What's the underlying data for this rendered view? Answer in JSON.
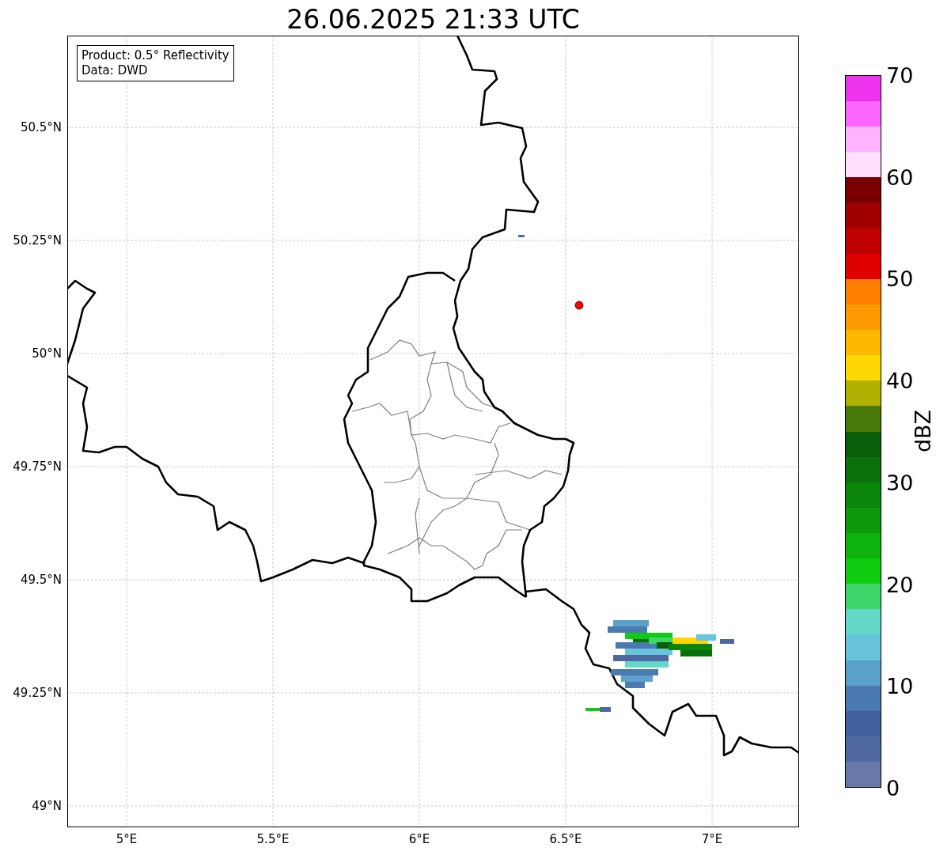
{
  "title": "26.06.2025 21:33 UTC",
  "info_box": [
    "Product: 0.5° Reflectivity",
    "Data: DWD"
  ],
  "map": {
    "y_ticks": [
      "50.5°N",
      "50.25°N",
      "50°N",
      "49.75°N",
      "49.5°N",
      "49.25°N",
      "49°N"
    ],
    "x_ticks": [
      "5°E",
      "5.5°E",
      "6°E",
      "6.5°E",
      "7°E"
    ]
  },
  "colorbar": {
    "label": "dBZ",
    "ticks": [
      "70",
      "60",
      "50",
      "40",
      "30",
      "20",
      "10",
      "0"
    ],
    "bands": [
      {
        "color": "#ee33ee"
      },
      {
        "color": "#ff66ff"
      },
      {
        "color": "#ffb3ff"
      },
      {
        "color": "#ffe0ff"
      },
      {
        "color": "#7a0000"
      },
      {
        "color": "#a00000"
      },
      {
        "color": "#c00000"
      },
      {
        "color": "#e00000"
      },
      {
        "color": "#ff7f00"
      },
      {
        "color": "#ff9900"
      },
      {
        "color": "#ffb800"
      },
      {
        "color": "#ffd700"
      },
      {
        "color": "#b0b000"
      },
      {
        "color": "#4a7a0a"
      },
      {
        "color": "#0a5e0a"
      },
      {
        "color": "#0a700a"
      },
      {
        "color": "#0a860a"
      },
      {
        "color": "#0c9a0c"
      },
      {
        "color": "#0eb40e"
      },
      {
        "color": "#10cc10"
      },
      {
        "color": "#3dd66a"
      },
      {
        "color": "#63d8c8"
      },
      {
        "color": "#68c4dc"
      },
      {
        "color": "#5aa0c8"
      },
      {
        "color": "#4a7ab0"
      },
      {
        "color": "#4260a0"
      },
      {
        "color": "#5068a0"
      },
      {
        "color": "#6878a8"
      }
    ]
  }
}
